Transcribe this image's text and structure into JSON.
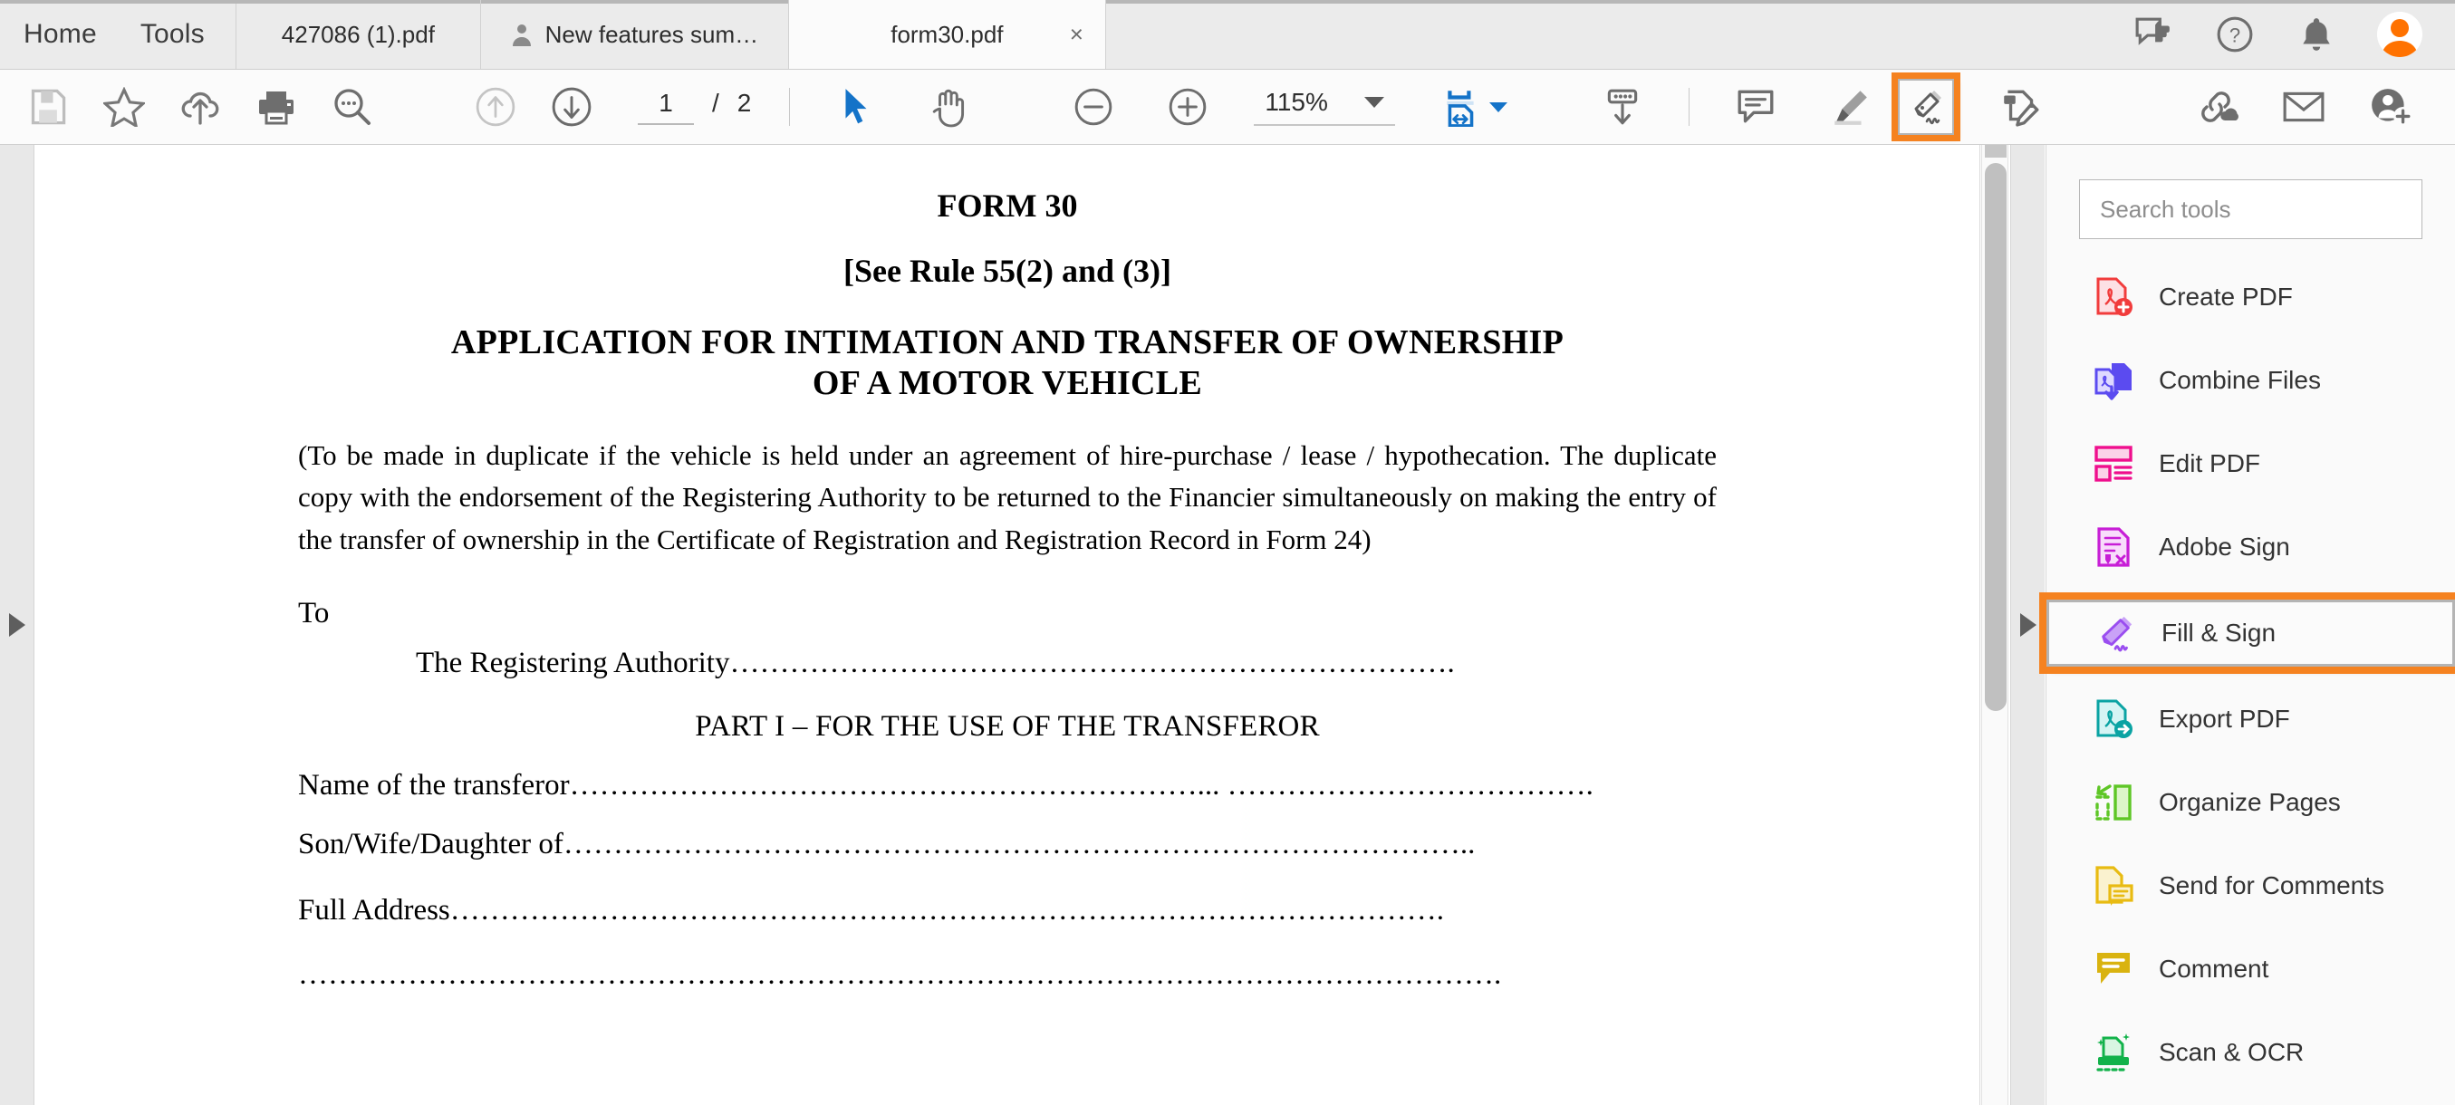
{
  "window": {
    "menu": [
      {
        "label": "Home",
        "name": "home-menu"
      },
      {
        "label": "Tools",
        "name": "tools-menu"
      }
    ],
    "tabs": [
      {
        "label": "427086 (1).pdf",
        "active": false,
        "shared": false
      },
      {
        "label": "New features sum…",
        "active": false,
        "shared": true
      },
      {
        "label": "form30.pdf",
        "active": true,
        "shared": false
      }
    ],
    "tab_close_label": "×",
    "right_icons": [
      {
        "name": "feedback-icon",
        "title": "Send feedback"
      },
      {
        "name": "help-icon",
        "title": "Help"
      },
      {
        "name": "notifications-bell-icon",
        "title": "Notifications"
      },
      {
        "name": "user-avatar",
        "title": "Account"
      }
    ]
  },
  "toolbar": {
    "left_tools": [
      {
        "name": "save-file-icon",
        "title": "Save file"
      },
      {
        "name": "add-to-favorites-star-icon",
        "title": "Add to favorites"
      },
      {
        "name": "upload-to-cloud-icon",
        "title": "Save to cloud"
      },
      {
        "name": "print-icon",
        "title": "Print file"
      },
      {
        "name": "find-text-icon",
        "title": "Find text"
      }
    ],
    "nav": {
      "previous_page_icon": "arrow-up-circle-icon",
      "next_page_icon": "arrow-down-circle-icon",
      "current_page": "1",
      "page_separator": "/",
      "total_pages": "2"
    },
    "cursor_tools": [
      {
        "name": "select-tool-icon",
        "title": "Select tool",
        "active": true
      },
      {
        "name": "hand-tool-icon",
        "title": "Hand tool",
        "active": false
      }
    ],
    "zoom": {
      "zoom_out_icon": "zoom-out-icon",
      "zoom_in_icon": "zoom-in-icon",
      "level": "115%",
      "dropdown_icon": "chevron-down-icon",
      "fit_page_icon": "fit-page-width-icon",
      "fit_page_dropdown_icon": "chevron-down-blue-icon",
      "scroll_mode_icon": "page-scrolling-icon"
    },
    "annotation_tools": [
      {
        "name": "add-comment-icon",
        "title": "Add comment",
        "highlighted": false
      },
      {
        "name": "highlighter-icon",
        "title": "Highlight text",
        "highlighted": false
      },
      {
        "name": "fill-and-sign-icon",
        "title": "Fill & Sign",
        "highlighted": true
      },
      {
        "name": "request-signatures-icon",
        "title": "Request e-signatures",
        "highlighted": false
      }
    ],
    "right_tools": [
      {
        "name": "share-link-icon",
        "title": "Share a link"
      },
      {
        "name": "email-icon",
        "title": "Send by email"
      },
      {
        "name": "invite-people-icon",
        "title": "Invite people"
      }
    ]
  },
  "document": {
    "form_number": "FORM 30",
    "rule_reference": "[See Rule 55(2) and (3)]",
    "title_line_1": "APPLICATION FOR INTIMATION AND TRANSFER OF OWNERSHIP",
    "title_line_2": "OF A MOTOR VEHICLE",
    "preamble": "(To be made in duplicate if the vehicle is held under an agreement of hire-purchase / lease / hypothecation. The duplicate copy with the endorsement of the Registering Authority to be returned to the Financier simultaneously on making the entry of the transfer of ownership in the Certificate of Registration and Registration Record in Form 24)",
    "to_label": "To",
    "registering_authority": "The Registering Authority……………………………………………………………….",
    "part_heading": "PART I – FOR THE USE OF THE TRANSFEROR",
    "field_name": "Name of the transferor………………………………………………………... ……………………………….",
    "field_relation": "Son/Wife/Daughter of………………………………………………………………………………..",
    "field_address": "Full Address……………………………………………………………………………………….",
    "field_address_cont": "…………………………………………………………………………………………………………."
  },
  "tools_panel": {
    "search_placeholder": "Search tools",
    "search_value": "",
    "items": [
      {
        "label": "Create PDF",
        "icon": "create-pdf-icon",
        "color": "#f13c3c",
        "selected": false
      },
      {
        "label": "Combine Files",
        "icon": "combine-files-icon",
        "color": "#5b4bf0",
        "selected": false
      },
      {
        "label": "Edit PDF",
        "icon": "edit-pdf-icon",
        "color": "#ef0f8d",
        "selected": false
      },
      {
        "label": "Adobe Sign",
        "icon": "adobe-sign-icon",
        "color": "#c71ed6",
        "selected": false
      },
      {
        "label": "Fill & Sign",
        "icon": "fill-and-sign-icon",
        "color": "#9a4ef0",
        "selected": true
      },
      {
        "label": "Export PDF",
        "icon": "export-pdf-icon",
        "color": "#0aa3a3",
        "selected": false
      },
      {
        "label": "Organize Pages",
        "icon": "organize-pages-icon",
        "color": "#5ec626",
        "selected": false
      },
      {
        "label": "Send for Comments",
        "icon": "send-for-comments-icon",
        "color": "#e8bb12",
        "selected": false
      },
      {
        "label": "Comment",
        "icon": "comment-icon",
        "color": "#d9b310",
        "selected": false
      },
      {
        "label": "Scan & OCR",
        "icon": "scan-and-ocr-icon",
        "color": "#12b24a",
        "selected": false
      }
    ]
  },
  "panel_controls": {
    "left_collapse_icon": "triangle-right-icon",
    "right_collapse_icon": "triangle-right-icon",
    "scrollbar_name": "vertical-scrollbar"
  },
  "colors": {
    "highlight_orange": "#f58220",
    "accent_blue": "#1473c8",
    "avatar_orange": "#ff7200"
  }
}
